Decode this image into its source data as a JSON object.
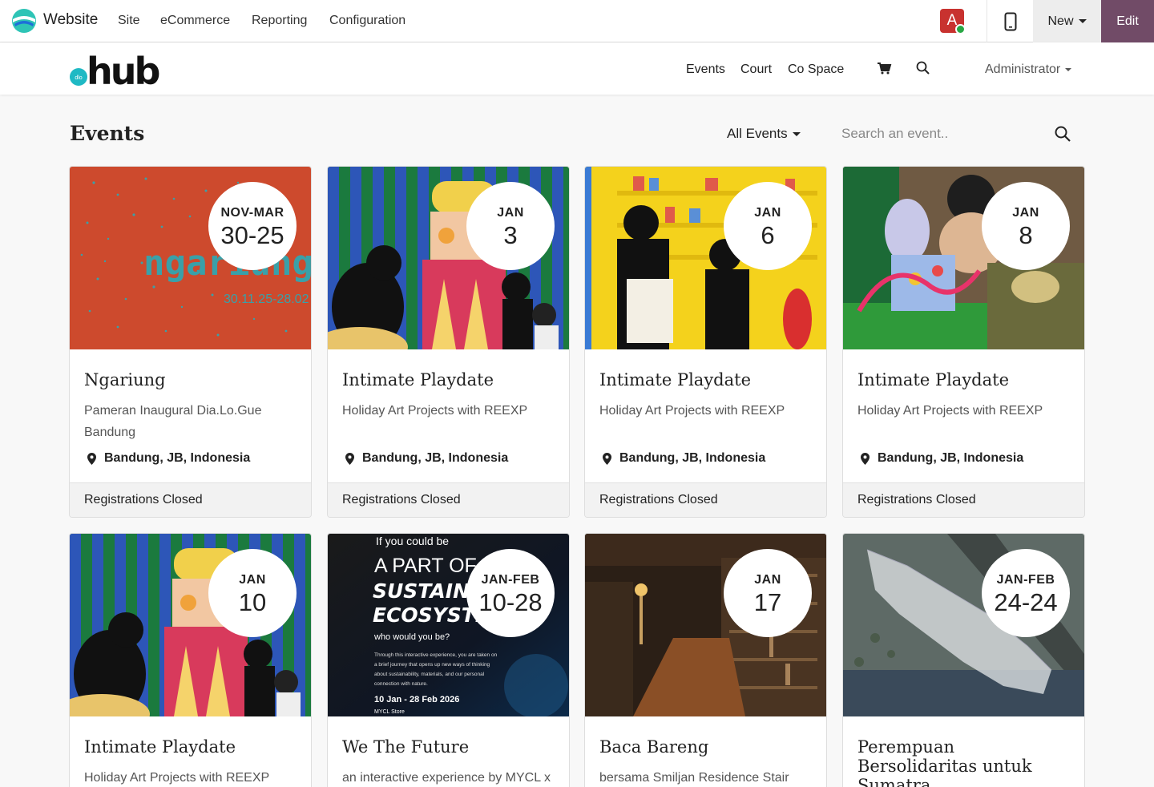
{
  "adminbar": {
    "app_title": "Website",
    "menu": [
      "Site",
      "eCommerce",
      "Reporting",
      "Configuration"
    ],
    "avatar_letter": "A",
    "new_label": "New",
    "edit_label": "Edit"
  },
  "site": {
    "logo_text": "hub",
    "nav": [
      "Events",
      "Court",
      "Co Space"
    ],
    "user_menu": "Administrator"
  },
  "events_page": {
    "title": "Events",
    "filter_label": "All Events",
    "search_placeholder": "Search an event.."
  },
  "cards": [
    {
      "month": "NOV-MAR",
      "day": "30-25",
      "title": "Ngariung",
      "subtitle": "Pameran Inaugural Dia.Lo.Gue Bandung",
      "location": "Bandung, JB, Indonesia",
      "status": "Registrations Closed",
      "image_text": "ngariung",
      "image_date": "30.11.25-28.02"
    },
    {
      "month": "JAN",
      "day": "3",
      "title": "Intimate Playdate",
      "subtitle": "Holiday Art Projects with REEXP",
      "location": "Bandung, JB, Indonesia",
      "status": "Registrations Closed"
    },
    {
      "month": "JAN",
      "day": "6",
      "title": "Intimate Playdate",
      "subtitle": "Holiday Art Projects with REEXP",
      "location": "Bandung, JB, Indonesia",
      "status": "Registrations Closed"
    },
    {
      "month": "JAN",
      "day": "8",
      "title": "Intimate Playdate",
      "subtitle": "Holiday Art Projects with REEXP",
      "location": "Bandung, JB, Indonesia",
      "status": "Registrations Closed"
    },
    {
      "month": "JAN",
      "day": "10",
      "title": "Intimate Playdate",
      "subtitle": "Holiday Art Projects with REEXP"
    },
    {
      "month": "JAN-FEB",
      "day": "10-28",
      "title": "We The Future",
      "subtitle": "an interactive experience by MYCL x",
      "poster": {
        "line1": "If you could be",
        "line2": "A PART OF",
        "line3": "SUSTAINABLE",
        "line4": "ECOSYSTEM,",
        "line5": "who would you be?",
        "body": [
          "Through this interactive experience, you are taken on",
          "a brief journey that opens up new ways of thinking",
          "about sustainability, materials, and our personal",
          "connection with nature."
        ],
        "dates": "10 Jan - 28 Feb 2026",
        "venue": "MYCL Store"
      }
    },
    {
      "month": "JAN",
      "day": "17",
      "title": "Baca Bareng",
      "subtitle": "bersama Smiljan Residence Stair"
    },
    {
      "month": "JAN-FEB",
      "day": "24-24",
      "title": "Perempuan Bersolidaritas untuk Sumatra",
      "subtitle": ""
    }
  ],
  "colors": {
    "edit_bg": "#714b67",
    "ngariung_bg": "#cd4a2d",
    "dot_teal": "#3aa0a8"
  }
}
